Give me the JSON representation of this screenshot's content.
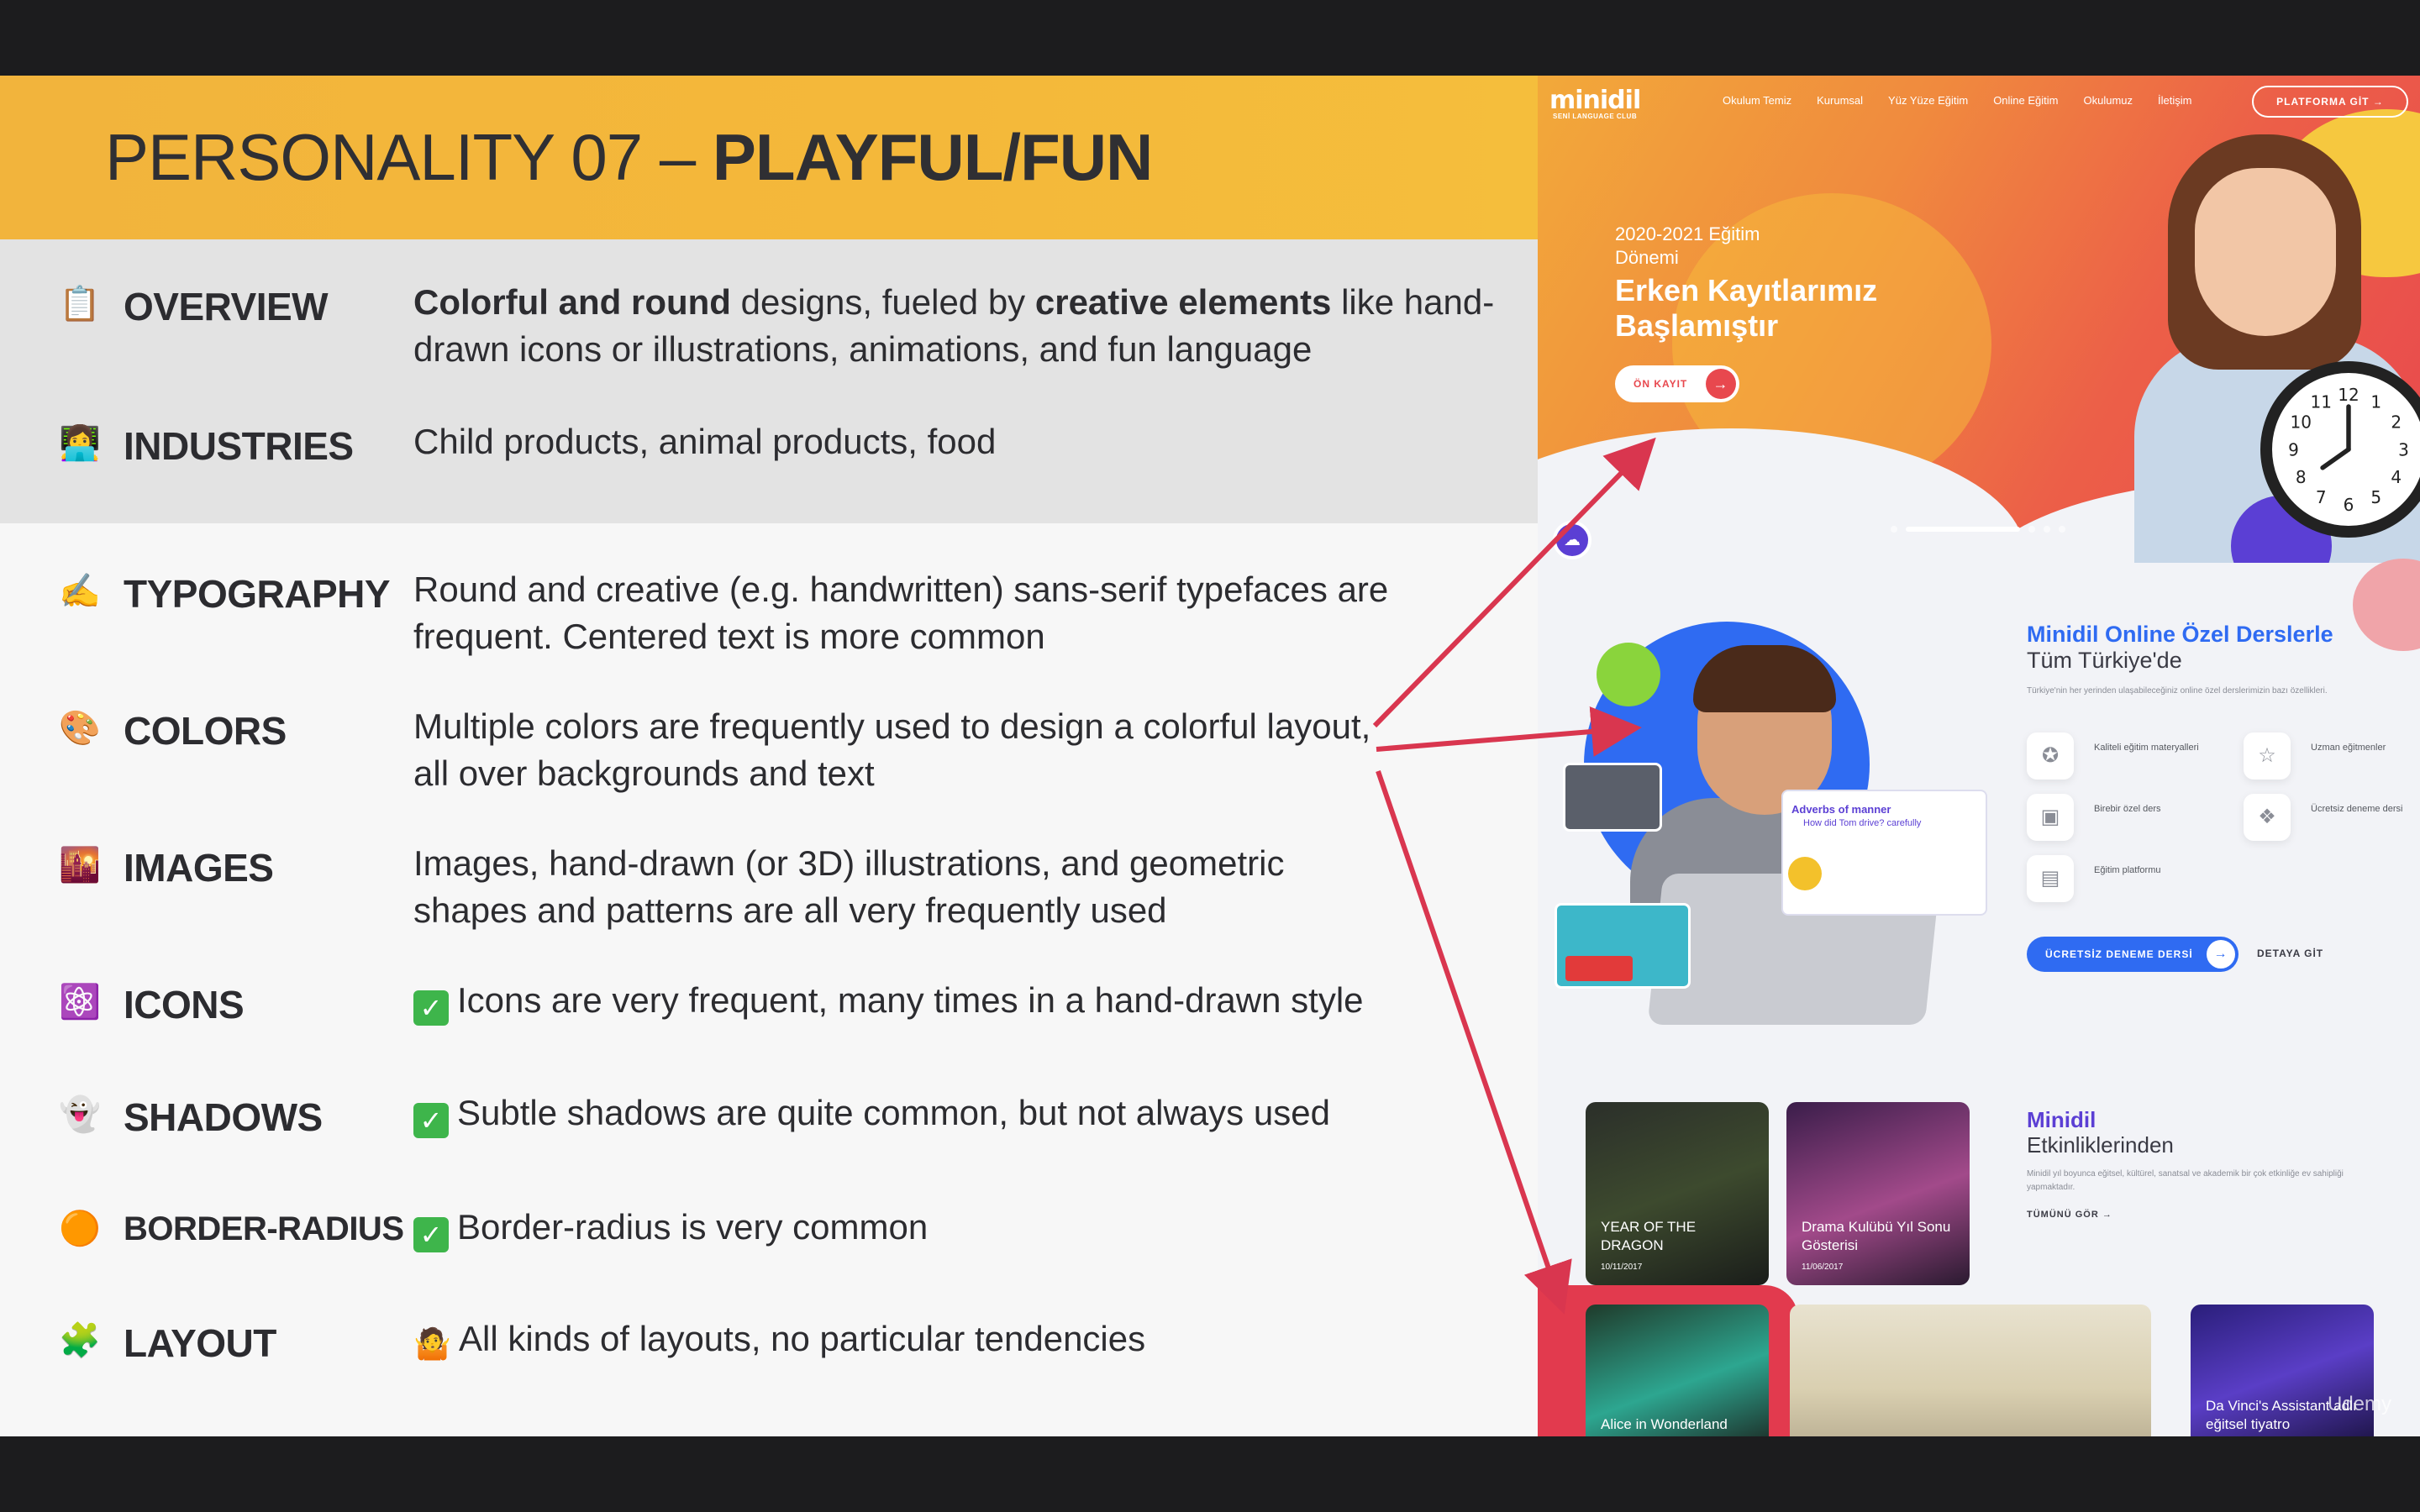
{
  "slide": {
    "title_light": "PERSONALITY 07 – ",
    "title_bold": "PLAYFUL/FUN",
    "rows": [
      {
        "icon": "📋",
        "label": "OVERVIEW"
      },
      {
        "icon": "👩‍💻",
        "label": "INDUSTRIES",
        "text": "Child products, animal products, food"
      },
      {
        "icon": "✍️",
        "label": "TYPOGRAPHY",
        "text": "Round and creative (e.g. handwritten) sans-serif typefaces are frequent. Centered text is more common"
      },
      {
        "icon": "🎨",
        "label": "COLORS",
        "text": "Multiple colors are frequently used to design a colorful layout, all over backgrounds and text"
      },
      {
        "icon": "🌇",
        "label": "IMAGES",
        "text": "Images, hand-drawn (or 3D) illustrations, and geometric shapes and patterns are all very frequently used"
      },
      {
        "icon": "⚛️",
        "label": "ICONS",
        "text": "Icons are very frequent, many times in a hand-drawn style"
      },
      {
        "icon": "👻",
        "label": "SHADOWS",
        "text": "Subtle shadows are quite common, but not always used"
      },
      {
        "icon": "🟠",
        "label": "BORDER-RADIUS",
        "text": "Border-radius is very common"
      },
      {
        "icon": "🧩",
        "label": "LAYOUT",
        "text": "All kinds of layouts, no particular tendencies"
      }
    ],
    "overview": {
      "bold1": "Colorful and round",
      "mid": " designs, fueled by ",
      "bold2": "creative elements",
      "rest": " like hand-drawn icons or illustrations, animations, and fun language"
    },
    "check_mark": "✓",
    "shrug_icon": "🤷"
  },
  "site": {
    "logo": "minidil",
    "logo_sub": "SENİ LANGUAGE CLUB",
    "nav": [
      "Okulum Temiz",
      "Kurumsal",
      "Yüz Yüze Eğitim",
      "Online Eğitim",
      "Okulumuz",
      "İletişim"
    ],
    "platform_btn": "PLATFORMA GİT  →",
    "hero_kicker": "2020-2021 Eğitim Dönemi",
    "hero_title": "Erken Kayıtlarımız Başlamıştır",
    "onkayit_btn": "ÖN KAYIT",
    "arrow_glyph": "→",
    "clock_numbers": [
      "12",
      "1",
      "2",
      "3",
      "4",
      "5",
      "6",
      "7",
      "8",
      "9",
      "10",
      "11"
    ],
    "s2_title": "Minidil Online Özel Derslerle",
    "s2_sub": "Tüm Türkiye'de",
    "s2_desc": "Türkiye'nin her yerinden ulaşabileceğiniz online özel derslerimizin bazı özellikleri.",
    "thumb_text1": "Adverbs of manner",
    "thumb_text2": "How did Tom drive? carefully",
    "features": [
      {
        "icon": "award-icon",
        "glyph": "✪",
        "text": "Kaliteli eğitim materyalleri"
      },
      {
        "icon": "star-icon",
        "glyph": "☆",
        "text": "Uzman eğitmenler"
      },
      {
        "icon": "video-icon",
        "glyph": "▣",
        "text": "Birebir özel ders"
      },
      {
        "icon": "gift-icon",
        "glyph": "❖",
        "text": "Ücretsiz deneme dersi"
      },
      {
        "icon": "platform-icon",
        "glyph": "▤",
        "text": "Eğitim platformu"
      }
    ],
    "deneme_btn": "ÜCRETSİZ DENEME DERSİ",
    "detay_link": "DETAYA GİT",
    "s3_title": "Minidil",
    "s3_sub": "Etkinliklerinden",
    "s3_desc": "Minidil yıl boyunca eğitsel, kültürel, sanatsal ve akademik bir çok etkinliğe ev sahipliği yapmaktadır.",
    "tumunu": "TÜMÜNÜ GÖR  →",
    "events": [
      {
        "title": "YEAR OF THE DRAGON",
        "date": "10/11/2017"
      },
      {
        "title": "Drama Kulübü Yıl Sonu Gösterisi",
        "date": "11/06/2017"
      },
      {
        "title": "Alice in Wonderland"
      },
      {
        "title": "Da Vinci's Assistant adlı eğitsel tiyatro"
      }
    ],
    "watermark": "Udemy"
  },
  "colors": {
    "title_bar": "#f2b43c",
    "arrow": "#d9364f",
    "brand_blue": "#2f6bf2",
    "brand_purple": "#5b3fd4",
    "brand_red": "#e8484e"
  }
}
